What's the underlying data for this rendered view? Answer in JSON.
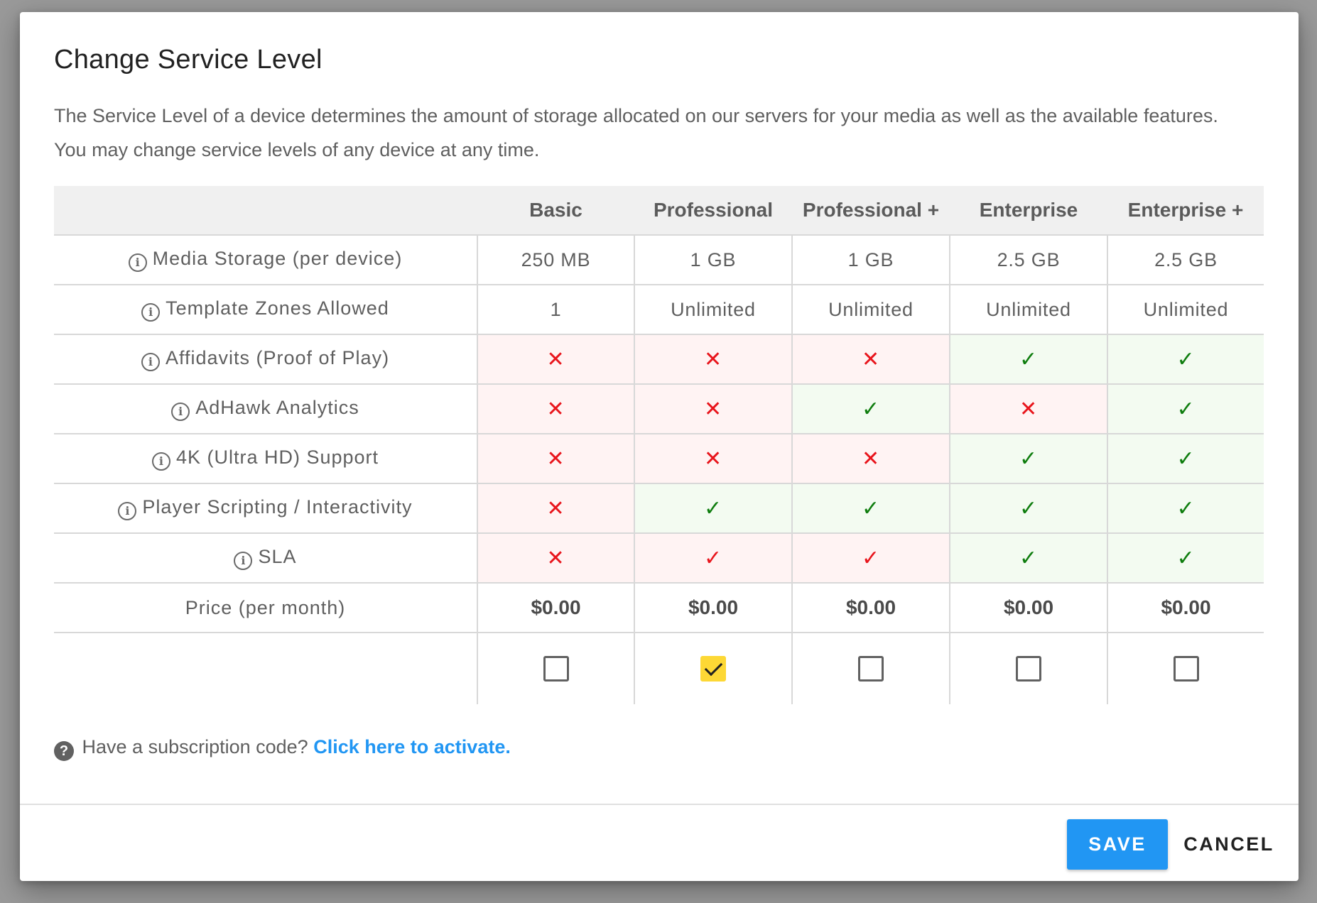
{
  "dialog": {
    "title": "Change Service Level",
    "description_line1": "The Service Level of a device determines the amount of storage allocated on our servers for your media as well as the available features.",
    "description_line2": "You may change service levels of any device at any time."
  },
  "table": {
    "columns": [
      "Basic",
      "Professional",
      "Professional +",
      "Enterprise",
      "Enterprise +"
    ],
    "rows": [
      {
        "feature": "Media Storage (per device)",
        "info": true,
        "type": "text",
        "cells": [
          "250 MB",
          "1 GB",
          "1 GB",
          "2.5 GB",
          "2.5 GB"
        ]
      },
      {
        "feature": "Template Zones Allowed",
        "info": true,
        "type": "text",
        "cells": [
          "1",
          "Unlimited",
          "Unlimited",
          "Unlimited",
          "Unlimited"
        ]
      },
      {
        "feature": "Affidavits (Proof of Play)",
        "info": true,
        "type": "mark",
        "cells": [
          "no",
          "no",
          "no",
          "yes",
          "yes"
        ]
      },
      {
        "feature": "AdHawk Analytics",
        "info": true,
        "type": "mark",
        "cells": [
          "no",
          "no",
          "yes",
          "no",
          "yes"
        ]
      },
      {
        "feature": "4K (Ultra HD) Support",
        "info": true,
        "type": "mark",
        "cells": [
          "no",
          "no",
          "no",
          "yes",
          "yes"
        ]
      },
      {
        "feature": "Player Scripting / Interactivity",
        "info": true,
        "type": "mark",
        "cells": [
          "no",
          "yes",
          "yes",
          "yes",
          "yes"
        ]
      },
      {
        "feature": "SLA",
        "info": true,
        "type": "mark",
        "cells": [
          "no",
          "partial",
          "partial",
          "yes",
          "yes"
        ]
      },
      {
        "feature": "Price (per month)",
        "info": false,
        "type": "price",
        "cells": [
          "$0.00",
          "$0.00",
          "$0.00",
          "$0.00",
          "$0.00"
        ]
      }
    ],
    "selected_index": 1
  },
  "marks": {
    "no_glyph": "✕",
    "yes_glyph": "✓",
    "no_color": "#e8141b",
    "yes_color": "#0e7d0e",
    "no_bg": "#fff3f3",
    "yes_bg": "#f3fbf1"
  },
  "subscription": {
    "prompt": "Have a subscription code?",
    "link": "Click here to activate."
  },
  "actions": {
    "save_label": "SAVE",
    "cancel_label": "CANCEL"
  },
  "colors": {
    "accent": "#2196f3",
    "checkbox_selected": "#fdd835"
  }
}
